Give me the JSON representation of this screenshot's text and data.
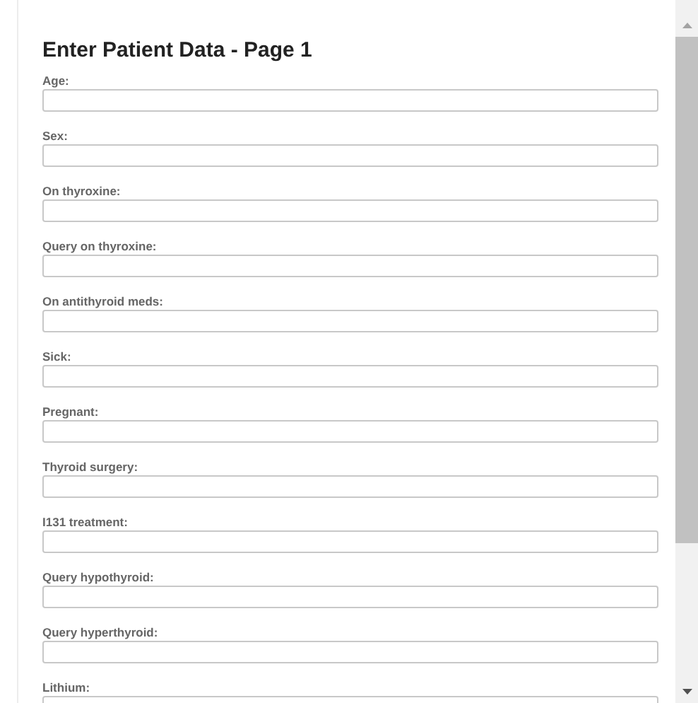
{
  "form": {
    "title": "Enter Patient Data - Page 1",
    "fields": [
      {
        "label": "Age:"
      },
      {
        "label": "Sex:"
      },
      {
        "label": "On thyroxine:"
      },
      {
        "label": "Query on thyroxine:"
      },
      {
        "label": "On antithyroid meds:"
      },
      {
        "label": "Sick:"
      },
      {
        "label": "Pregnant:"
      },
      {
        "label": "Thyroid surgery:"
      },
      {
        "label": "I131 treatment:"
      },
      {
        "label": "Query hypothyroid:"
      },
      {
        "label": "Query hyperthyroid:"
      },
      {
        "label": "Lithium:"
      }
    ]
  }
}
